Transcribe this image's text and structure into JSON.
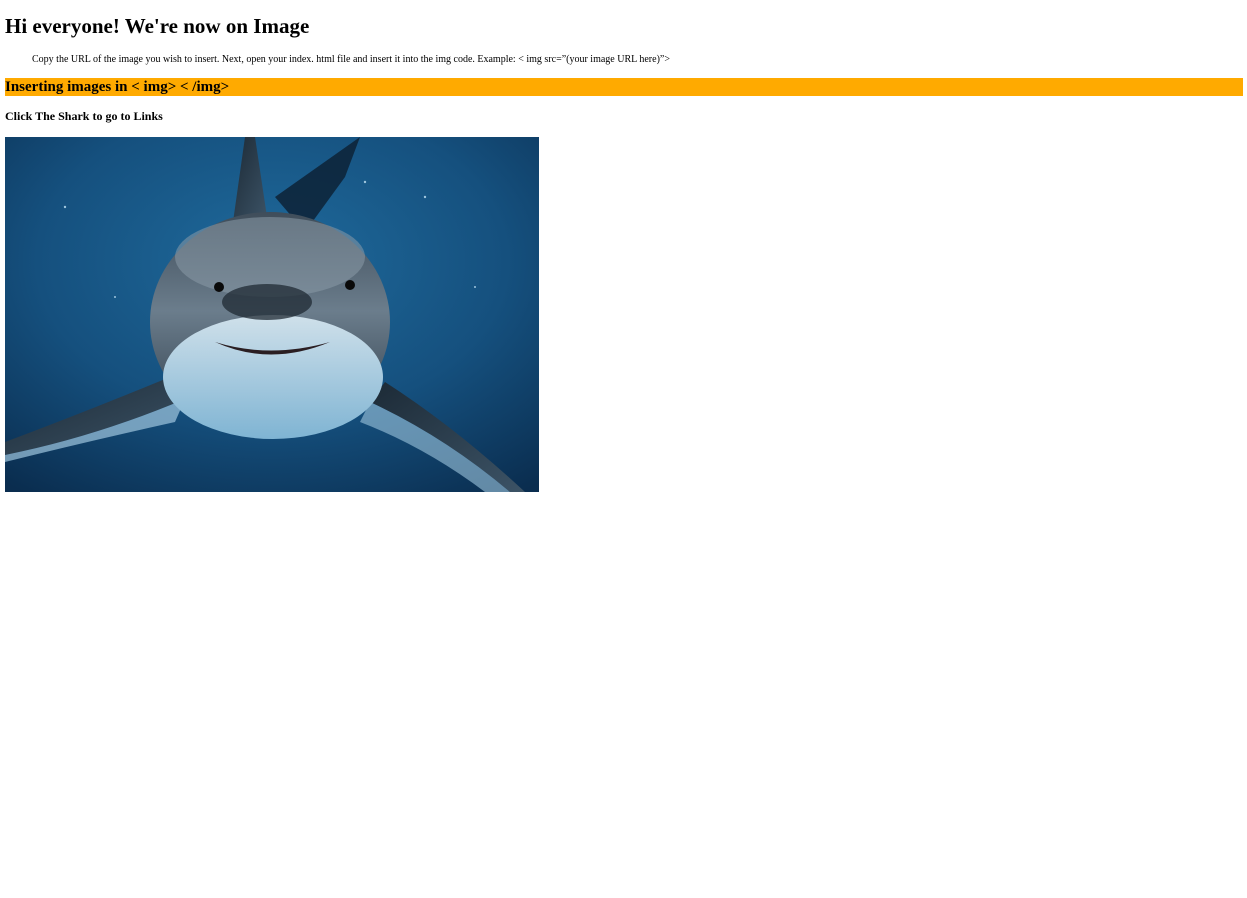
{
  "page": {
    "title": "Hi everyone! We're now on Image",
    "intro": "Copy the URL of the image you wish to insert. Next, open your index. html file and insert it into the img code. Example: < img src=”(your image URL here)”>",
    "section_heading": "Inserting images in < img> < /img>",
    "click_hint": "Click The Shark to go to Links"
  },
  "shark_image": {
    "icon": "shark-photo",
    "description_colors": {
      "water_dark": "#0b2f52",
      "water_light": "#1a5e8f",
      "shark_body": "#5a6b7a",
      "shark_belly": "#e8eef2"
    }
  },
  "colors": {
    "banner": "#ffaa00",
    "text": "#000000",
    "background": "#ffffff"
  }
}
